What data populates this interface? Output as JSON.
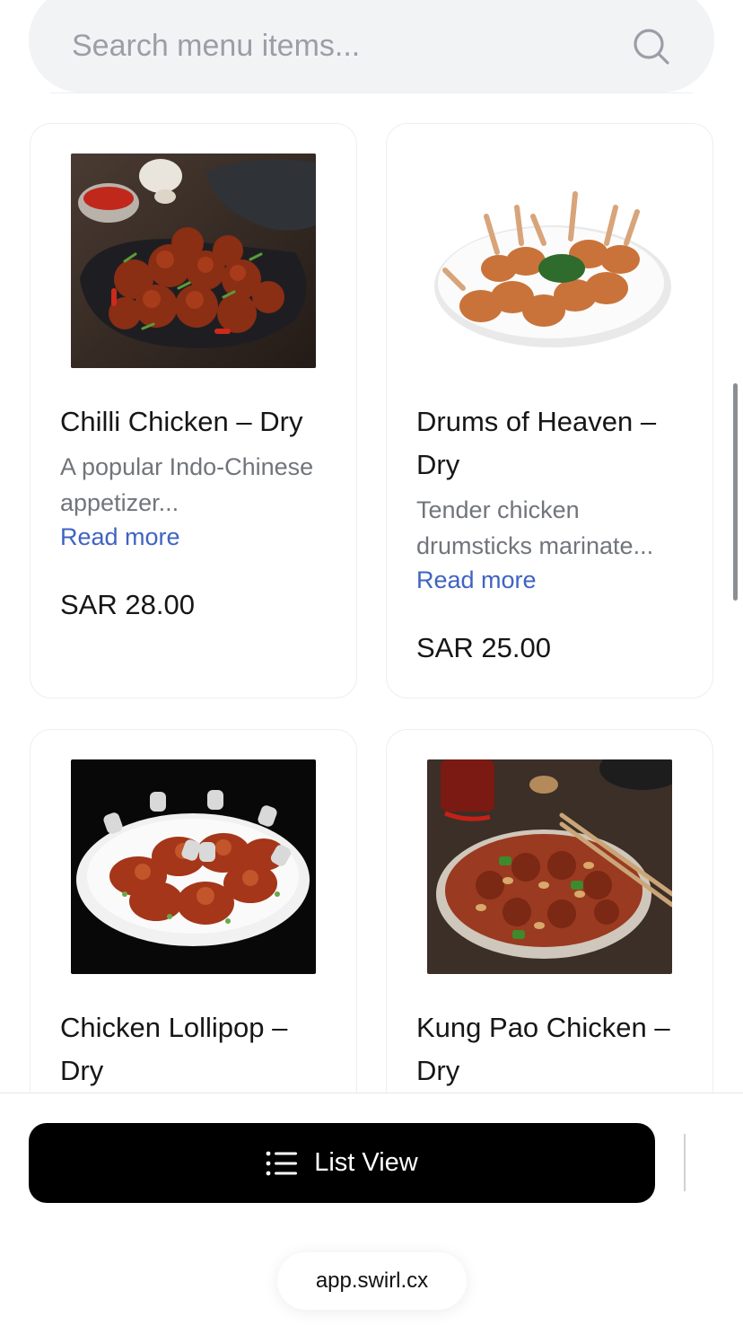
{
  "search": {
    "placeholder": "Search menu items...",
    "icon": "search-icon"
  },
  "items": [
    {
      "title": "Chilli Chicken – Dry",
      "description": "A popular Indo-Chinese appetizer...",
      "read_more": "Read more",
      "price": "SAR 28.00"
    },
    {
      "title": "Drums of Heaven – Dry",
      "description": "Tender chicken drumsticks marinate...",
      "read_more": "Read more",
      "price": "SAR 25.00"
    },
    {
      "title": "Chicken Lollipop – Dry"
    },
    {
      "title": "Kung Pao Chicken – Dry"
    }
  ],
  "bottom_bar": {
    "list_view_label": "List View",
    "list_icon": "list-icon"
  },
  "browser": {
    "url": "app.swirl.cx"
  },
  "colors": {
    "link": "#3f63c2",
    "button": "#000000",
    "search_bg": "#f2f3f5"
  }
}
